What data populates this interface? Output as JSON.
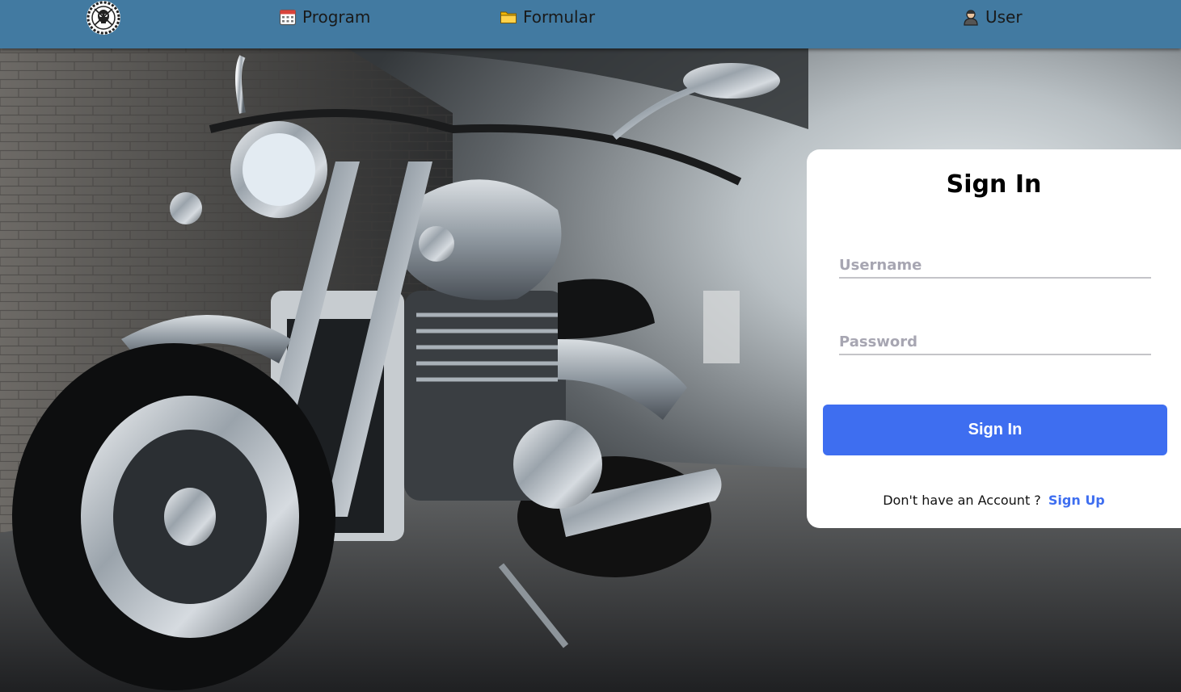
{
  "nav": {
    "logo_icon": "skull-gear-logo-icon",
    "items": [
      {
        "label": "Program",
        "icon": "calendar-icon"
      },
      {
        "label": "Formular",
        "icon": "folder-icon"
      },
      {
        "label": "User",
        "icon": "user-icon"
      }
    ],
    "background_color": "#427aa1"
  },
  "background": {
    "image": "motorcycle-tunnel-photo"
  },
  "signin": {
    "title": "Sign In",
    "username_placeholder": "Username",
    "password_placeholder": "Password",
    "submit_label": "Sign In",
    "prompt_text": "Don't have an Account ?",
    "signup_link": "Sign Up",
    "accent_color": "#3e6ef0"
  }
}
